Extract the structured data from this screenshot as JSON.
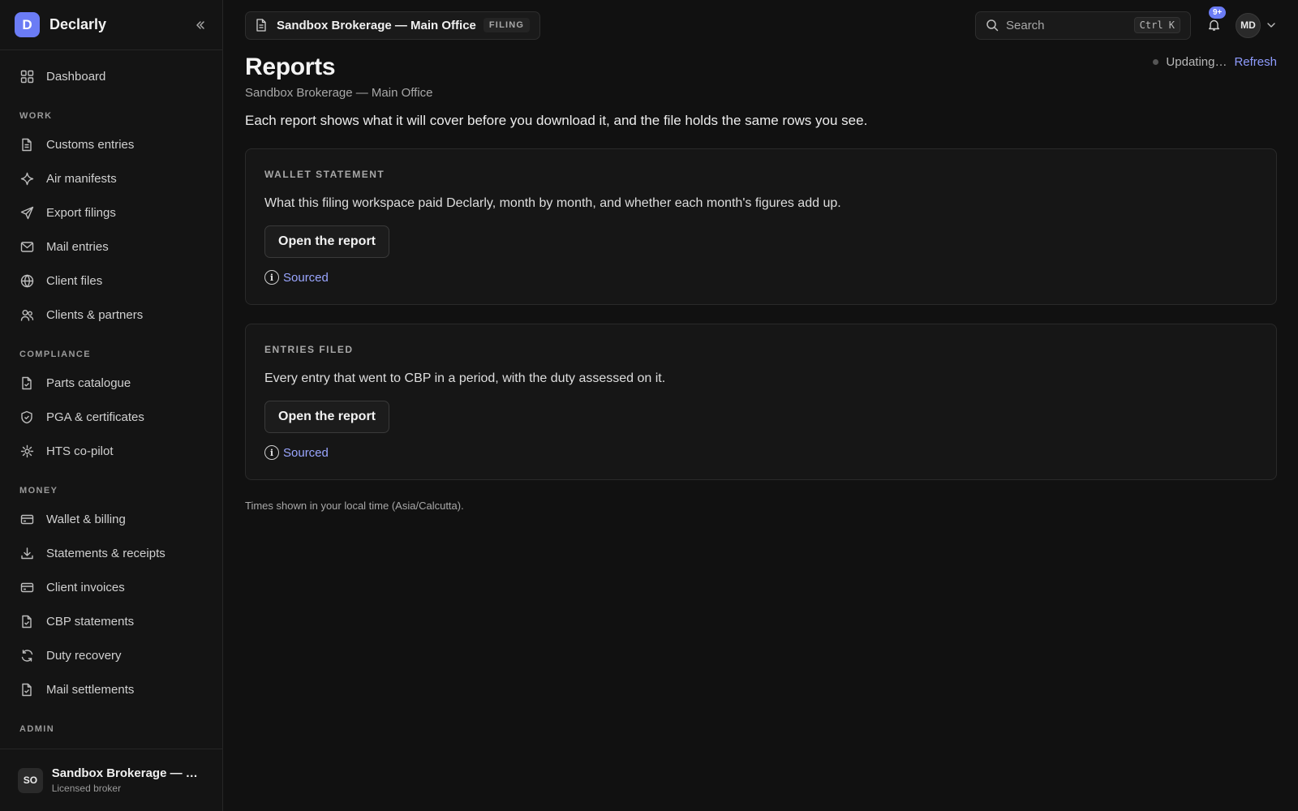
{
  "brand": {
    "logo_letter": "D",
    "name": "Declarly"
  },
  "sidebar": {
    "top_items": [
      {
        "label": "Dashboard",
        "icon": "grid-icon"
      }
    ],
    "sections": [
      {
        "title": "WORK",
        "items": [
          {
            "label": "Customs entries",
            "icon": "document-icon"
          },
          {
            "label": "Air manifests",
            "icon": "sparkle-icon"
          },
          {
            "label": "Export filings",
            "icon": "send-icon"
          },
          {
            "label": "Mail entries",
            "icon": "mail-icon"
          },
          {
            "label": "Client files",
            "icon": "globe-icon"
          },
          {
            "label": "Clients & partners",
            "icon": "users-icon"
          }
        ]
      },
      {
        "title": "COMPLIANCE",
        "items": [
          {
            "label": "Parts catalogue",
            "icon": "file-check-icon"
          },
          {
            "label": "PGA & certificates",
            "icon": "shield-check-icon"
          },
          {
            "label": "HTS co-pilot",
            "icon": "sun-icon"
          }
        ]
      },
      {
        "title": "MONEY",
        "items": [
          {
            "label": "Wallet & billing",
            "icon": "card-icon"
          },
          {
            "label": "Statements & receipts",
            "icon": "download-icon"
          },
          {
            "label": "Client invoices",
            "icon": "card-icon"
          },
          {
            "label": "CBP statements",
            "icon": "file-check-icon"
          },
          {
            "label": "Duty recovery",
            "icon": "refresh-icon"
          },
          {
            "label": "Mail settlements",
            "icon": "file-check-icon"
          }
        ]
      },
      {
        "title": "ADMIN",
        "items": []
      }
    ],
    "account": {
      "initials": "SO",
      "name": "Sandbox Brokerage — Main Office",
      "role": "Licensed broker"
    }
  },
  "topbar": {
    "workspace_name": "Sandbox Brokerage — Main Office",
    "workspace_tag": "FILING",
    "search_placeholder": "Search",
    "search_shortcut": "Ctrl K",
    "notifications_badge": "9+",
    "user_initials": "MD"
  },
  "page": {
    "title": "Reports",
    "subtitle": "Sandbox Brokerage — Main Office",
    "status_text": "Updating…",
    "refresh_label": "Refresh",
    "intro": "Each report shows what it will cover before you download it, and the file holds the same rows you see.",
    "reports": [
      {
        "kicker": "WALLET STATEMENT",
        "description": "What this filing workspace paid Declarly, month by month, and whether each month's figures add up.",
        "button": "Open the report",
        "sourced": "Sourced"
      },
      {
        "kicker": "ENTRIES FILED",
        "description": "Every entry that went to CBP in a period, with the duty assessed on it.",
        "button": "Open the report",
        "sourced": "Sourced"
      }
    ],
    "footnote": "Times shown in your local time (Asia/Calcutta)."
  },
  "colors": {
    "accent": "#6b7cf5",
    "link": "#8f9cff",
    "background": "#111111"
  }
}
